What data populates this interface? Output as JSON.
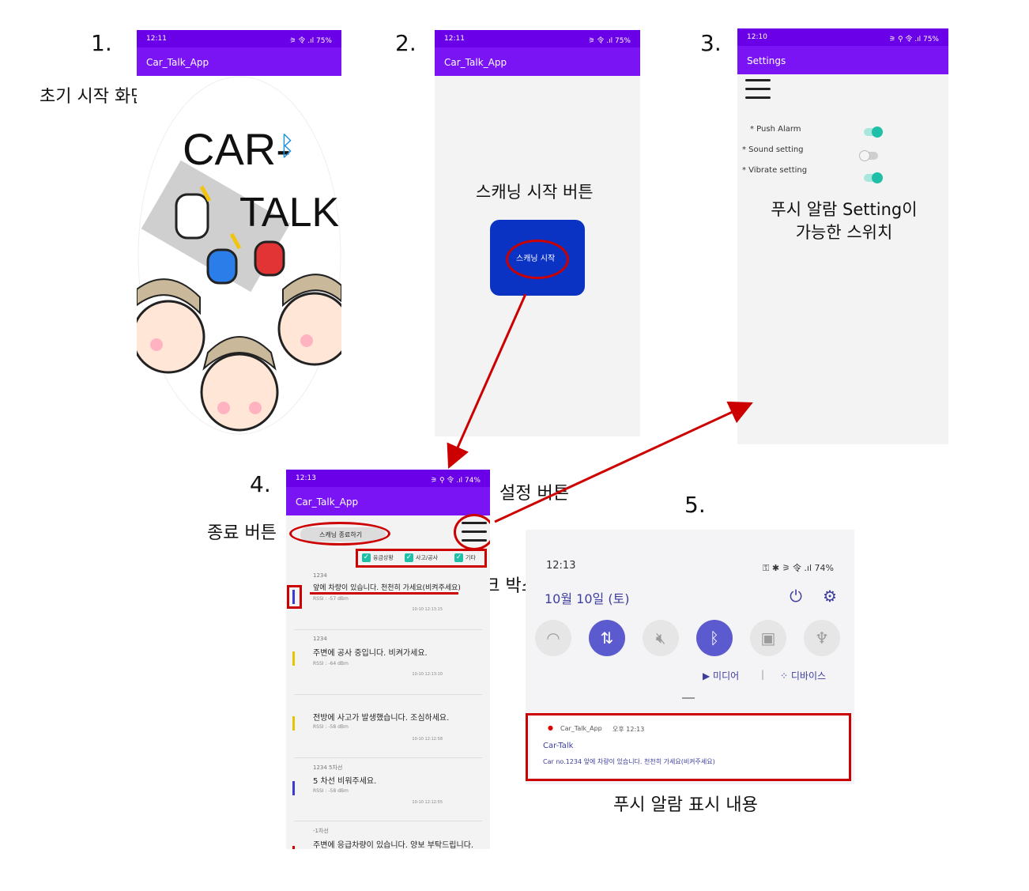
{
  "steps": {
    "s1": {
      "num": "1.",
      "caption": "초기 시작 화면"
    },
    "s2": {
      "num": "2.",
      "caption": "스캐닝 시작 버튼"
    },
    "s3": {
      "num": "3.",
      "caption_line1": "푸시 알람 Setting이",
      "caption_line2": "가능한 스위치"
    },
    "s4": {
      "num": "4.",
      "caption_exit": "종료 버튼",
      "caption_settings": "설정 버튼",
      "caption_checkbox": "체크 박스"
    },
    "s5": {
      "num": "5.",
      "caption": "푸시 알람 표시 내용"
    }
  },
  "phone1": {
    "status_time": "12:11",
    "status_right": "⚞ 令 .ıl 75%",
    "app_title": "Car_Talk_App",
    "logo_line1": "CAR-",
    "logo_line2": "TALK"
  },
  "phone2": {
    "status_time": "12:11",
    "status_right": "⚞ 令 .ıl 75%",
    "app_title": "Car_Talk_App",
    "scan_button_label": "스캐닝 시작",
    "scan_button_color": "#0a33c4"
  },
  "phone3": {
    "status_time": "12:10",
    "status_right": "⚞ ⚲ 令 .ıl 75%",
    "app_title": "Settings",
    "settings": [
      {
        "label": "* Push Alarm",
        "state": "on"
      },
      {
        "label": "* Sound setting",
        "state": "off"
      },
      {
        "label": "* Vibrate setting",
        "state": "on"
      }
    ]
  },
  "phone4": {
    "status_time": "12:13",
    "status_right": "⚞ ⚲ 令 .ıl 74%",
    "app_title": "Car_Talk_App",
    "stop_button_label": "스캐닝 종료하기",
    "checkboxes": [
      "응급상황",
      "사고/공사",
      "기타"
    ],
    "messages": [
      {
        "id": "1234",
        "text": "앞에 차량이 있습니다. 천천히 가세요(비켜주세요)",
        "rssi": "RSSI : -57 dBm",
        "date": "10-10 12:13:15",
        "color": "#3b3bd6"
      },
      {
        "id": "1234",
        "text": "주변에 공사 중입니다. 비켜가세요.",
        "rssi": "RSSI : -64 dBm",
        "date": "10-10 12:13:10",
        "color": "#e8c400"
      },
      {
        "id": "",
        "text": "전방에 사고가 발생했습니다. 조심하세요.",
        "rssi": "RSSI : -58 dBm",
        "date": "10-10 12:12:58",
        "color": "#e8c400"
      },
      {
        "id": "1234  5차선",
        "text": "5 차선 비워주세요.",
        "rssi": "RSSI : -58 dBm",
        "date": "10-10 12:12:55",
        "color": "#3b3bd6"
      },
      {
        "id": "-1차선",
        "text": "주변에 응급차량이 있습니다. 양보 부탁드립니다.",
        "rssi": "",
        "date": "",
        "color": "#d00000"
      }
    ]
  },
  "phone5": {
    "time": "12:13",
    "status_right": "⚿ ✱ ⚞ 令 .ıl 74%",
    "date": "10월 10일 (토)",
    "media_label": "미디어",
    "devices_label": "디바이스",
    "notif_app": "Car_Talk_App",
    "notif_time": "오후 12:13",
    "notif_title": "Car-Talk",
    "notif_body": "Car no.1234 앞에 차량이 있습니다. 천천히 가세요(비켜주세요)"
  }
}
